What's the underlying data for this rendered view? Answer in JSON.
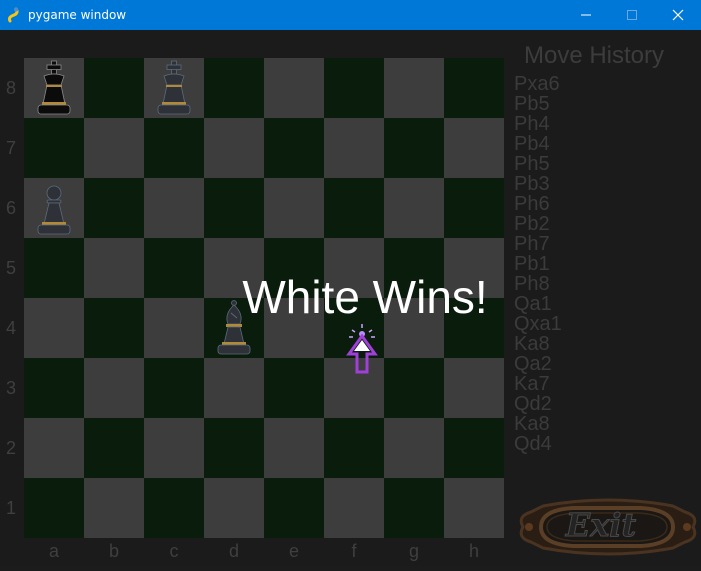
{
  "window": {
    "title": "pygame window",
    "minimize_icon": "minimize-icon",
    "maximize_icon": "maximize-icon",
    "close_icon": "close-icon"
  },
  "board": {
    "ranks": [
      "8",
      "7",
      "6",
      "5",
      "4",
      "3",
      "2",
      "1"
    ],
    "files": [
      "a",
      "b",
      "c",
      "d",
      "e",
      "f",
      "g",
      "h"
    ],
    "colors": {
      "light": "#3d3d3d",
      "dark": "#0a1d0d"
    },
    "pieces": [
      {
        "square": "a8",
        "piece": "king",
        "color": "black"
      },
      {
        "square": "c8",
        "piece": "king",
        "color": "white"
      },
      {
        "square": "a6",
        "piece": "pawn",
        "color": "white"
      },
      {
        "square": "d4",
        "piece": "bishop",
        "color": "white"
      }
    ]
  },
  "history": {
    "title": "Move History",
    "moves": [
      "Pxa6",
      "Pb5",
      "Ph4",
      "Pb4",
      "Ph5",
      "Pb3",
      "Ph6",
      "Pb2",
      "Ph7",
      "Pb1",
      "Ph8",
      "Qa1",
      "Qxa1",
      "Ka8",
      "Qa2",
      "Ka7",
      "Qd2",
      "Ka8",
      "Qd4"
    ]
  },
  "result": {
    "text": "White Wins!"
  },
  "exit_button": {
    "label": "Exit"
  }
}
